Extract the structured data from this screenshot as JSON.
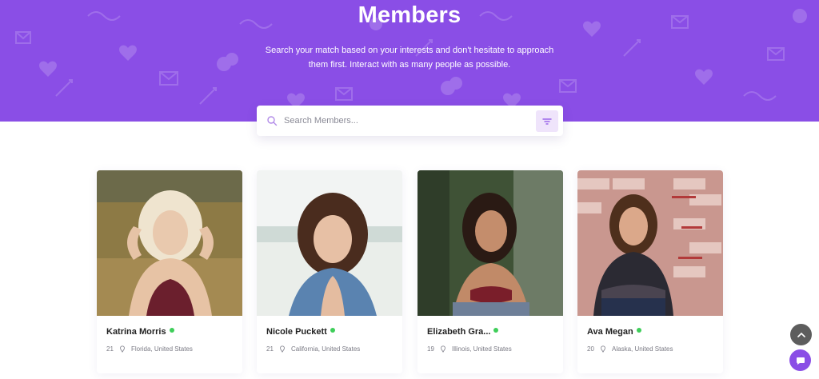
{
  "hero": {
    "title": "Members",
    "description": "Search your match based on your interests and don't hesitate to approach them first. Interact with as many people as possible.",
    "background_color": "#8a4ee6"
  },
  "search": {
    "placeholder": "Search Members...",
    "value": "",
    "icon": "search-icon",
    "filter_icon": "filter-icon"
  },
  "members": [
    {
      "name": "Katrina Morris",
      "age": "21",
      "location": "Florida, United States",
      "online": true
    },
    {
      "name": "Nicole Puckett",
      "age": "21",
      "location": "California, United States",
      "online": true
    },
    {
      "name": "Elizabeth Gra...",
      "age": "19",
      "location": "Illinois, United States",
      "online": true
    },
    {
      "name": "Ava Megan",
      "age": "20",
      "location": "Alaska, United States",
      "online": true
    }
  ],
  "colors": {
    "accent": "#8a4ee6",
    "online": "#3fce5a",
    "scroll_top": "#5d5d5d"
  },
  "floating": {
    "scroll_top_icon": "chevron-up-icon",
    "chat_icon": "chat-icon"
  }
}
